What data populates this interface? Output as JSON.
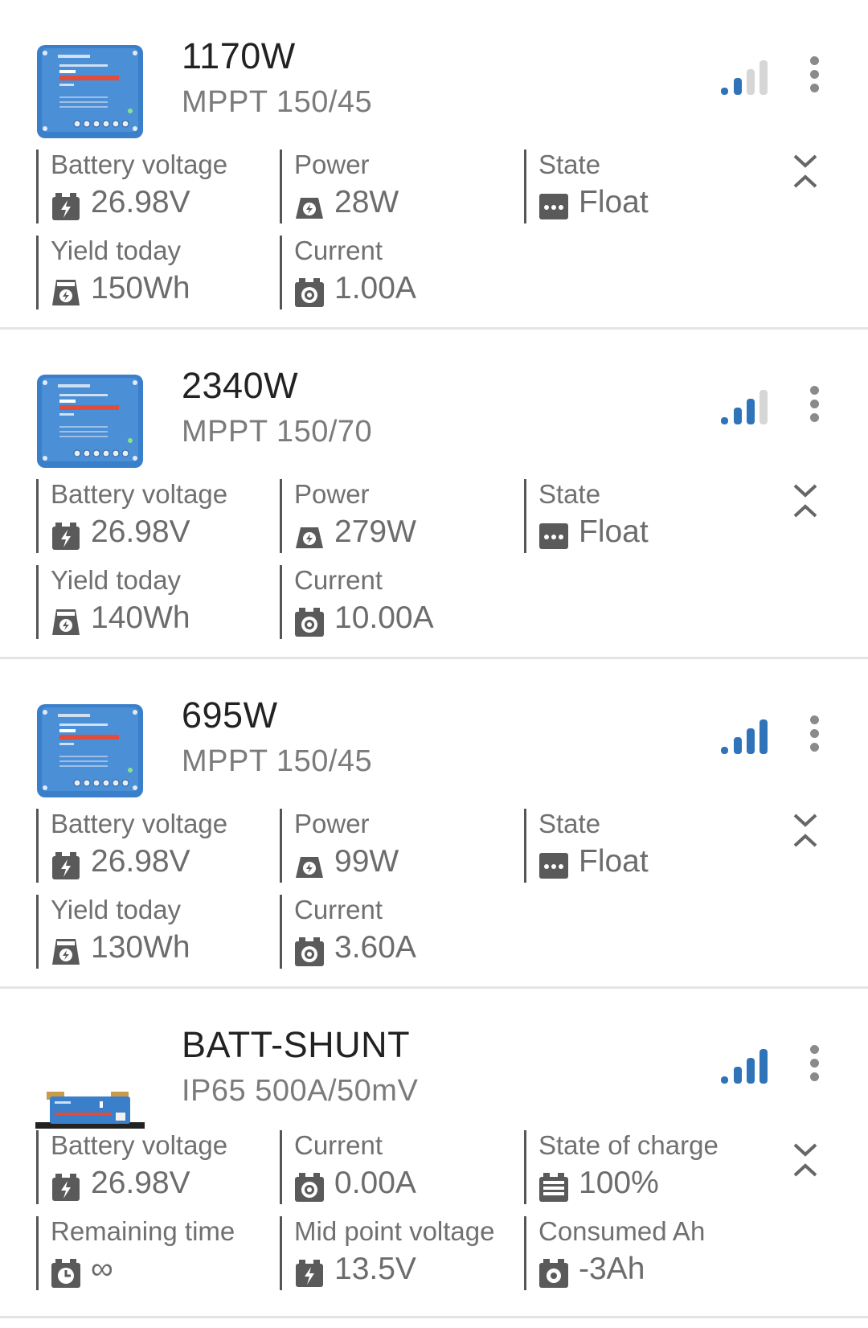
{
  "devices": [
    {
      "title": "1170W",
      "model": "MPPT 150/45",
      "image": "mppt-charge-controller",
      "signal": {
        "bars_active": 2,
        "bars_total": 4
      },
      "fields": [
        {
          "label": "Battery voltage",
          "icon": "battery-bolt-icon",
          "value": "26.98V"
        },
        {
          "label": "Power",
          "icon": "power-icon",
          "value": "28W"
        },
        {
          "label": "State",
          "icon": "state-dots-icon",
          "value": "Float"
        },
        {
          "label": "Yield today",
          "icon": "yield-today-icon",
          "value": "150Wh"
        },
        {
          "label": "Current",
          "icon": "current-icon",
          "value": "1.00A"
        }
      ]
    },
    {
      "title": "2340W",
      "model": "MPPT 150/70",
      "image": "mppt-charge-controller",
      "signal": {
        "bars_active": 3,
        "bars_total": 4
      },
      "fields": [
        {
          "label": "Battery voltage",
          "icon": "battery-bolt-icon",
          "value": "26.98V"
        },
        {
          "label": "Power",
          "icon": "power-icon",
          "value": "279W"
        },
        {
          "label": "State",
          "icon": "state-dots-icon",
          "value": "Float"
        },
        {
          "label": "Yield today",
          "icon": "yield-today-icon",
          "value": "140Wh"
        },
        {
          "label": "Current",
          "icon": "current-icon",
          "value": "10.00A"
        }
      ]
    },
    {
      "title": "695W",
      "model": "MPPT 150/45",
      "image": "mppt-charge-controller",
      "signal": {
        "bars_active": 4,
        "bars_total": 4
      },
      "fields": [
        {
          "label": "Battery voltage",
          "icon": "battery-bolt-icon",
          "value": "26.98V"
        },
        {
          "label": "Power",
          "icon": "power-icon",
          "value": "99W"
        },
        {
          "label": "State",
          "icon": "state-dots-icon",
          "value": "Float"
        },
        {
          "label": "Yield today",
          "icon": "yield-today-icon",
          "value": "130Wh"
        },
        {
          "label": "Current",
          "icon": "current-icon",
          "value": "3.60A"
        }
      ]
    },
    {
      "title": "BATT-SHUNT",
      "model": "IP65 500A/50mV",
      "image": "battery-shunt",
      "signal": {
        "bars_active": 4,
        "bars_total": 4
      },
      "fields": [
        {
          "label": "Battery voltage",
          "icon": "battery-bolt-icon",
          "value": "26.98V"
        },
        {
          "label": "Current",
          "icon": "current-icon",
          "value": "0.00A"
        },
        {
          "label": "State of charge",
          "icon": "state-of-charge-icon",
          "value": "100%"
        },
        {
          "label": "Remaining time",
          "icon": "clock-icon",
          "value": "∞"
        },
        {
          "label": "Mid point voltage",
          "icon": "battery-bolt-icon",
          "value": "13.5V"
        },
        {
          "label": "Consumed Ah",
          "icon": "consumed-ah-icon",
          "value": "-3Ah"
        }
      ]
    }
  ],
  "colors": {
    "signal_active": "#2f73b8",
    "signal_inactive": "#d6d6d6",
    "device_blue": "#3a7fca",
    "icon_grey": "#5a5a5a"
  }
}
